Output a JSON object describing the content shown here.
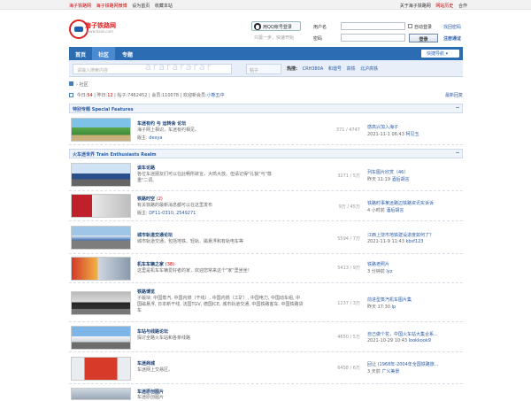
{
  "topbar": {
    "left_links": [
      "海子铁路网",
      "海子铁路网微博",
      "设为首页",
      "收藏本站"
    ],
    "right_links": [
      "关于海子铁路网",
      "网站历史",
      "合作"
    ]
  },
  "logo": {
    "name": "海子铁路网",
    "sub": "www.haizi.com"
  },
  "login": {
    "qq_button": "用QQ帐号登录",
    "qq_sub": "只需一步，快速开始",
    "user_label": "用户名",
    "password_label": "密码",
    "auto_login": "自动登录",
    "find_password": "找回密码",
    "login_button": "登录",
    "register": "注册通证"
  },
  "nav": {
    "tabs": [
      "首页",
      "社区",
      "专题"
    ],
    "quick_nav": "快捷导航"
  },
  "search": {
    "placeholder": "请输入搜索内容",
    "scope": "帖子",
    "hot_label": "热搜:",
    "hot_terms": [
      "CRH380A",
      "和谐号",
      "高铁",
      "北沪高铁"
    ]
  },
  "breadcrumb": {
    "current": "社区"
  },
  "stats": {
    "today_label": "今日:",
    "today": "54",
    "yesterday_label": "昨日:",
    "yesterday": "12",
    "posts_label": "帖子:",
    "posts": "7462452",
    "members_label": "会员:",
    "members": "110078",
    "newest_label": "欢迎新会员:",
    "newest": "小熊五中",
    "latest_replies": "最新回复"
  },
  "sections": [
    {
      "title": "特别专题 Special Features"
    },
    {
      "title": "火车迷世界 Train Enthusiasts Realm"
    }
  ],
  "forums": [
    {
      "title": "车迷有约 与 运转会 论坛",
      "today": "",
      "desc": "海子网上相识，车迷有约相见。",
      "mod_label": "版主:",
      "mod": "dexya",
      "counts": "371 / 4747",
      "last": "感高兴加入海子",
      "time": "2021-11-1 06:43",
      "user": "柯见玉"
    },
    {
      "title": "谈车论路",
      "today": "",
      "desc": "各位车迷朋友们可以在此畅所欲言，大鸣大放。但请记得\"礼貌\"与\"尊重\"二词。",
      "mod_label": "",
      "mod": "",
      "counts": "3271 / 5万",
      "last": "列车图片欣赏（46）",
      "time": "昨天 11:19",
      "user": "酒后胡言"
    },
    {
      "title": "铁路时空",
      "today": "(2)",
      "desc": "有关铁路的最新消息都可以在这里发布",
      "mod_label": "版主:",
      "mod": "DF11-0310, 2549271",
      "counts": "9万 / 45万",
      "last": "铁路时事某远路边铁路资讯实诉诉",
      "time": "4 小时前",
      "user": "酒后胡言"
    },
    {
      "title": "城市轨道交通论坛",
      "today": "",
      "desc": "城市轨道交通，包括地铁、轻轨、磁悬浮和有轨电车等",
      "mod_label": "",
      "mod": "",
      "counts": "5594 / 7万",
      "last": "江西上饶市地铁建设进度如何了？",
      "time": "2021-11-9 11:43",
      "user": "kbsf123"
    },
    {
      "title": "机车车辆之家",
      "today": "(38)",
      "desc": "这里是机车车辆爱好者的家，欢迎您常来这个\"家\"里坐坐！",
      "mod_label": "",
      "mod": "",
      "counts": "5413 / 9万",
      "last": "铁路老照片",
      "time": "3 分钟前",
      "user": "lyz"
    },
    {
      "title": "铁路博览",
      "today": "",
      "desc": "子版块: 中国蒸汽, 中国内燃（干线）, 中国内燃（工矿）, 中国电力, 中国动车组, 中国磁悬浮, 日本新干线, 法国TGV, 德国ICE, 城市轨道交通, 中国铁路客车, 中国铁路货车",
      "mod_label": "",
      "mod": "",
      "counts": "1237 / 3万",
      "last": "前进型蒸汽机车图片集",
      "time": "昨天 17:30",
      "user": "lp"
    },
    {
      "title": "车站与线路论坛",
      "today": "",
      "desc": "探讨全路火车站和各条线路",
      "mod_label": "",
      "mod": "",
      "counts": "4650 / 5万",
      "last": "自己做个花，中国火车站大集合系...",
      "time": "2021-10-29 10:43",
      "user": "lookkook9"
    },
    {
      "title": "车迷商城",
      "today": "",
      "desc": "车迷网上交易区。",
      "mod_label": "",
      "mod": "",
      "counts": "6458 / 6万",
      "last": "回让 (1968年-2004年全国铁路旅...",
      "time": "3 天前",
      "user": "广义美景"
    },
    {
      "title": "车迷原创图片",
      "today": "",
      "desc": "车迷原创图片",
      "mod_label": "",
      "mod": "",
      "counts": "",
      "last": "",
      "time": "",
      "user": ""
    }
  ]
}
